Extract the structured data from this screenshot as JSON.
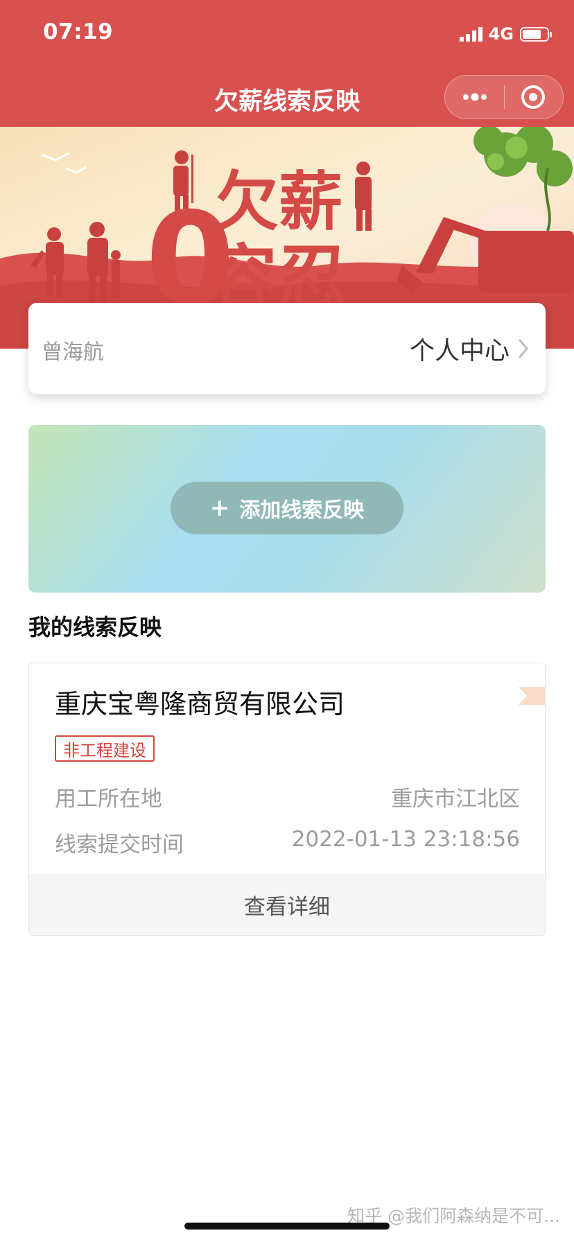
{
  "status_bar": {
    "time": "07:19",
    "network": "4G",
    "battery_level": 0.75
  },
  "nav": {
    "title": "欠薪线索反映",
    "more_icon": "more-dots-icon",
    "close_icon": "target-circle-icon"
  },
  "banner": {
    "slogan_top": "欠薪",
    "slogan_zero": "0",
    "slogan_bottom": "容忍"
  },
  "user": {
    "name": "曾海航",
    "personal_center_label": "个人中心"
  },
  "add": {
    "label": "添加线索反映",
    "icon": "plus-icon"
  },
  "section": {
    "title": "我的线索反映"
  },
  "clues": [
    {
      "company": "重庆宝粤隆商贸有限公司",
      "tag": "非工程建设",
      "location_label": "用工所在地",
      "location_value": "重庆市江北区",
      "time_label": "线索提交时间",
      "time_value": "2022-01-13 23:18:56",
      "detail_label": "查看详细"
    }
  ],
  "watermark": "知乎 @我们阿森纳是不可...",
  "colors": {
    "primary_red": "#d9514f",
    "tag_red": "#d5443f",
    "button_teal": "#8fb8b6"
  }
}
